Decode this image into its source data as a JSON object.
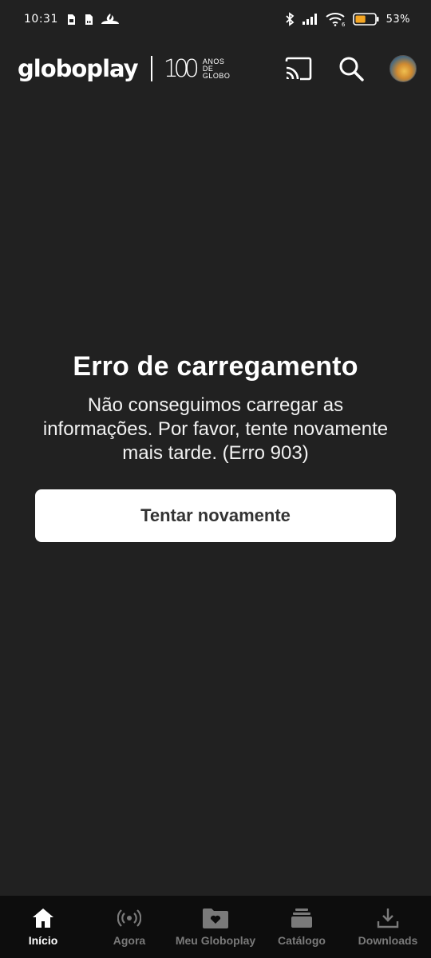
{
  "status_bar": {
    "time": "10:31",
    "battery_percent": "53%",
    "battery_level": 0.53,
    "battery_color": "#f5a623",
    "icons": [
      "sim-card-icon",
      "sd-card-icon",
      "santander-icon",
      "bluetooth-icon",
      "signal-icon",
      "wifi-icon",
      "battery-icon"
    ]
  },
  "header": {
    "brand": "globoplay",
    "anniversary_number": "100",
    "anniversary_words": [
      "ANOS",
      "DE",
      "GLOBO"
    ],
    "actions": [
      "cast-icon",
      "search-icon",
      "avatar"
    ]
  },
  "error": {
    "title": "Erro de carregamento",
    "message": "Não conseguimos carregar as informações. Por favor, tente novamente mais tarde. (Erro 903)",
    "retry_label": "Tentar novamente"
  },
  "bottom_nav": {
    "items": [
      {
        "label": "Início",
        "icon": "home-icon",
        "active": true
      },
      {
        "label": "Agora",
        "icon": "live-broadcast-icon",
        "active": false
      },
      {
        "label": "Meu Globoplay",
        "icon": "heart-folder-icon",
        "active": false
      },
      {
        "label": "Catálogo",
        "icon": "catalog-stack-icon",
        "active": false
      },
      {
        "label": "Downloads",
        "icon": "download-icon",
        "active": false
      }
    ]
  },
  "colors": {
    "background": "#212121",
    "nav_background": "#0d0d0d",
    "active": "#ffffff",
    "inactive": "#7a7a7a"
  }
}
